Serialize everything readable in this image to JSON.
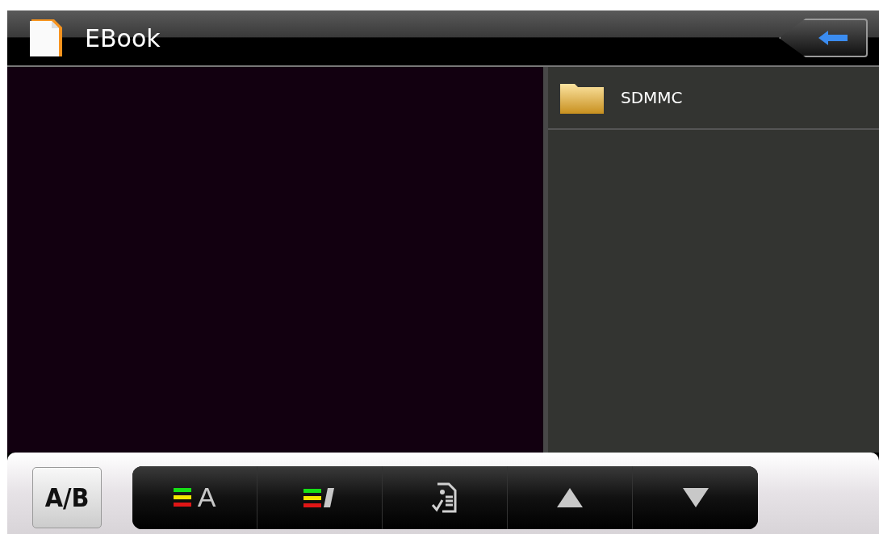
{
  "window": {
    "title": "EBook"
  },
  "files": [
    {
      "kind": "folder",
      "name": "SDMMC"
    }
  ],
  "toolbar": {
    "mode_button": "A/B",
    "buttons": [
      {
        "kind": "text-color",
        "label": "A"
      },
      {
        "kind": "pen-color"
      },
      {
        "kind": "document"
      },
      {
        "kind": "up"
      },
      {
        "kind": "down"
      }
    ]
  }
}
